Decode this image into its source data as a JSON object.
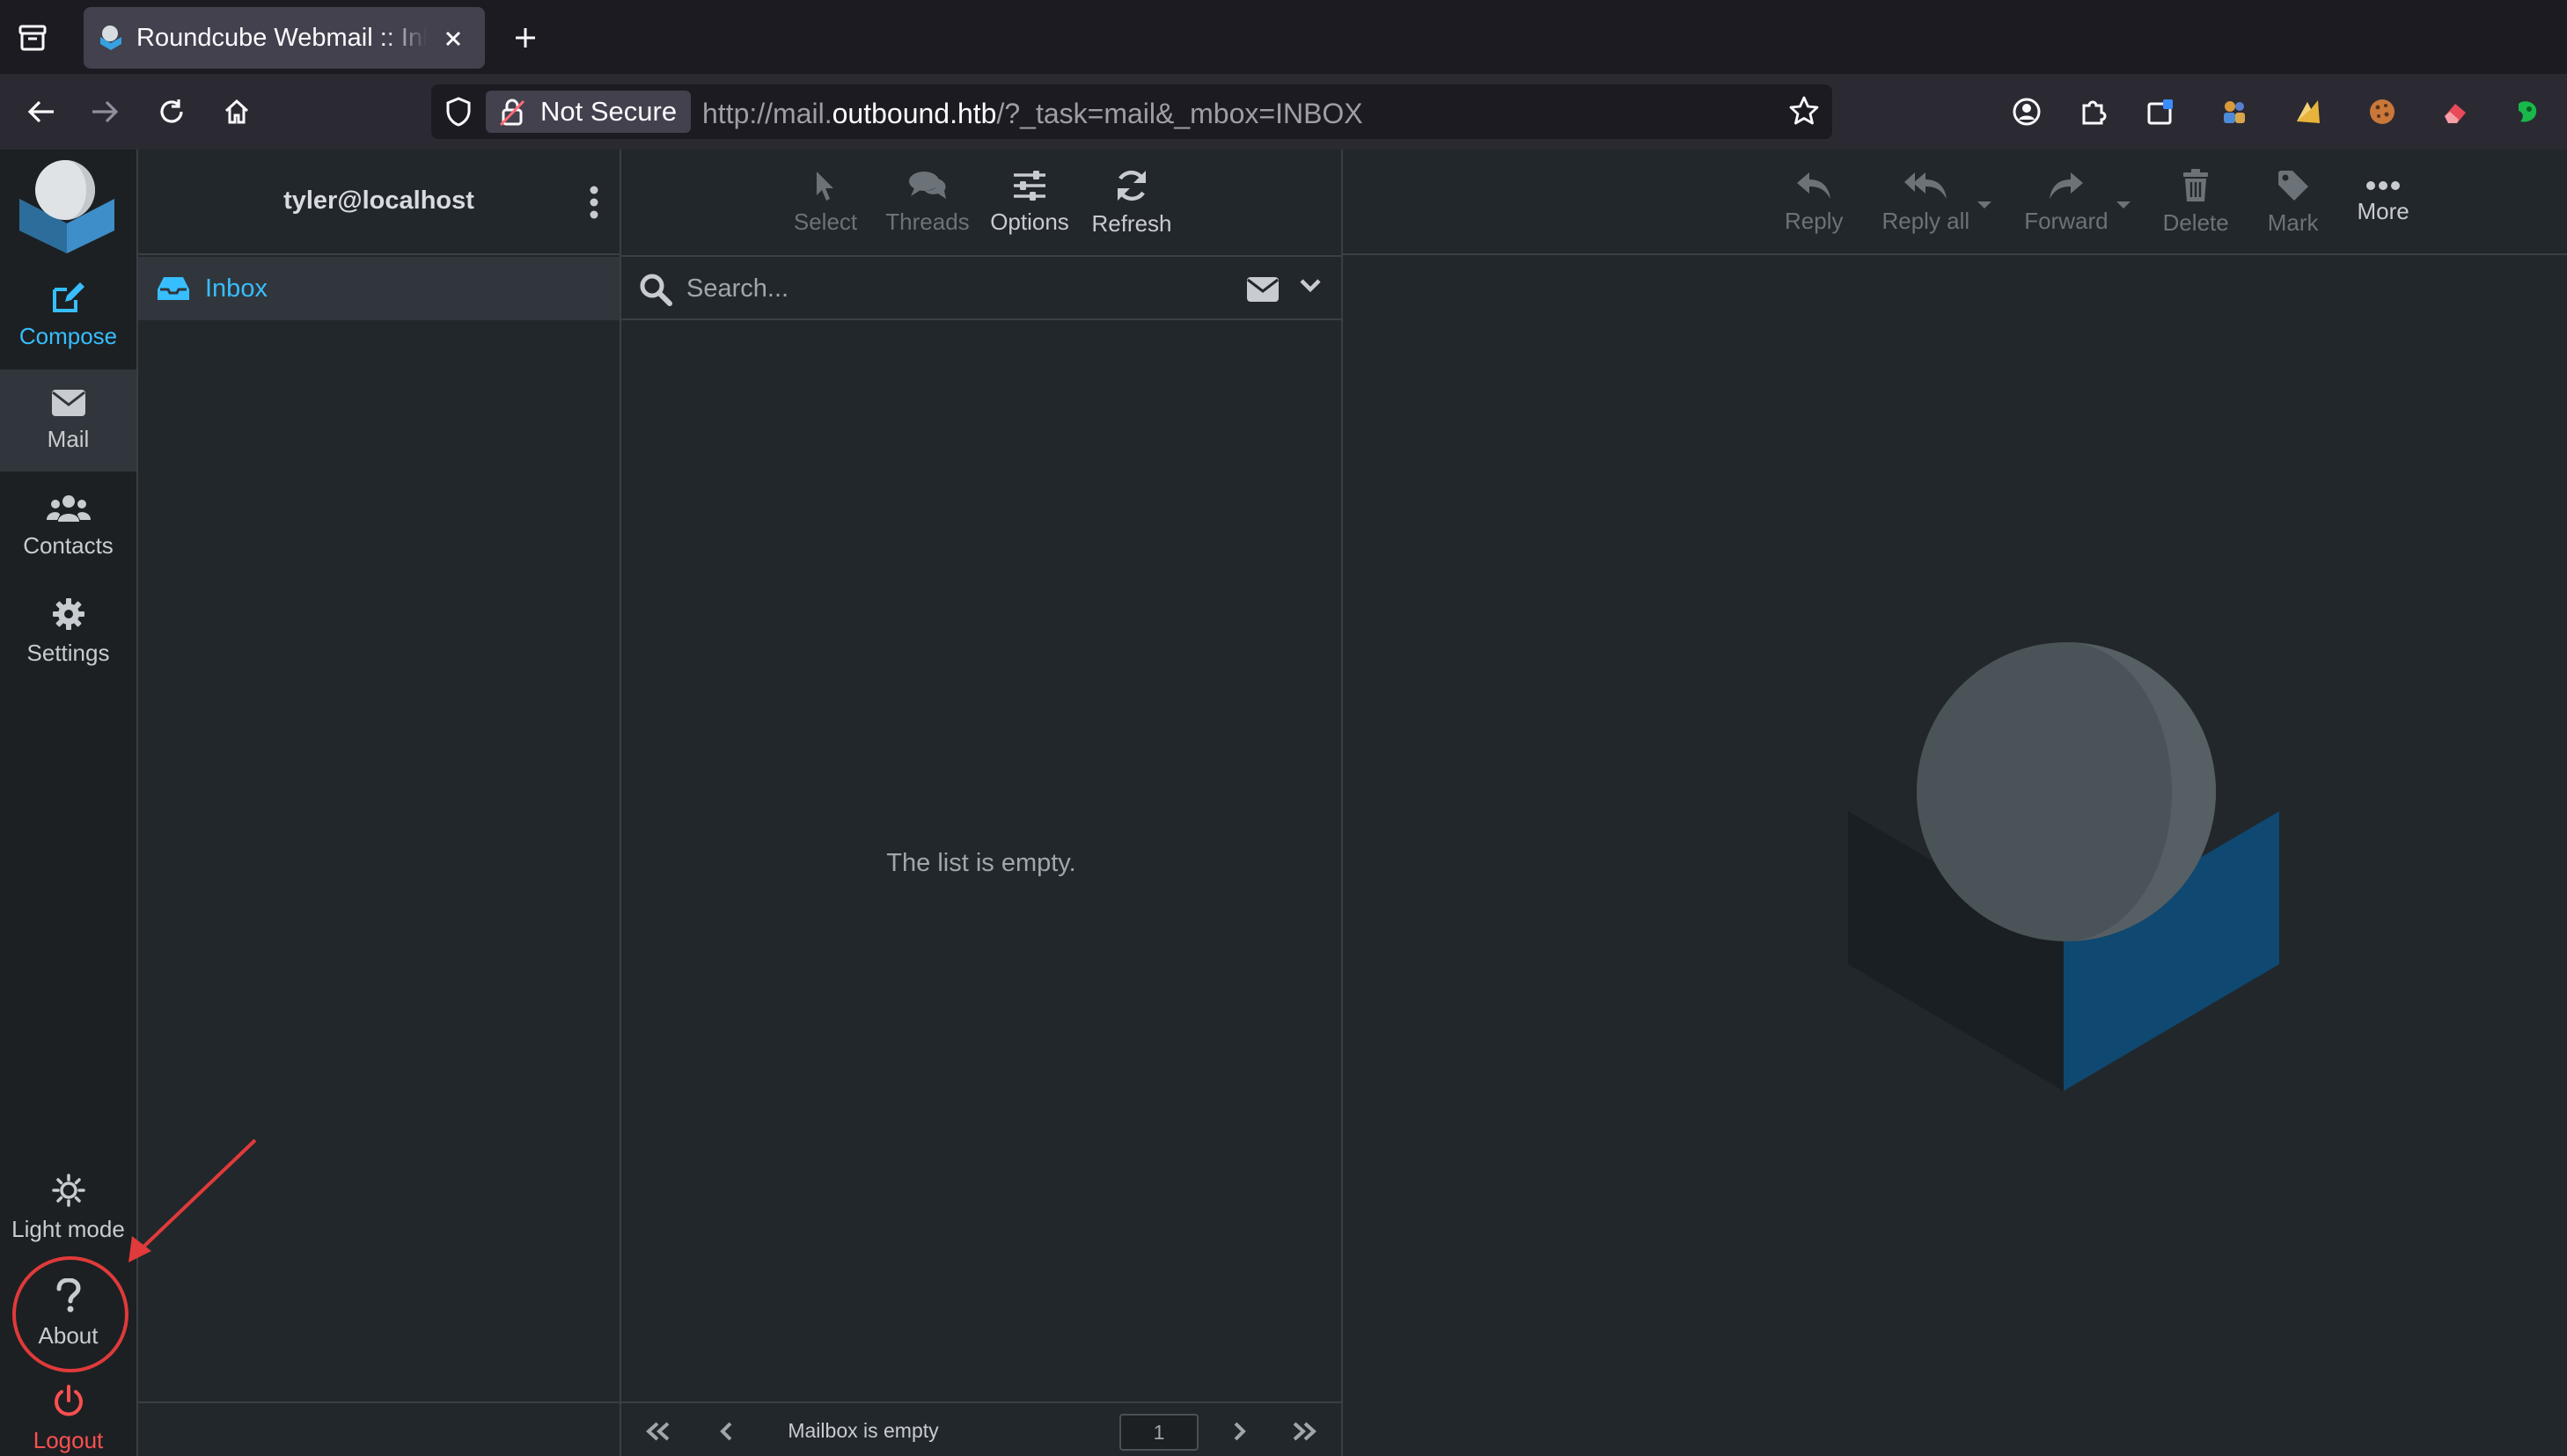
{
  "browser": {
    "tab_title": "Roundcube Webmail :: Inbox",
    "security_label": "Not Secure",
    "url_prefix": "http://mail.",
    "url_host": "outbound.htb",
    "url_path": "/?_task=mail&_mbox=INBOX"
  },
  "taskmenu": {
    "compose": "Compose",
    "mail": "Mail",
    "contacts": "Contacts",
    "settings": "Settings",
    "light_mode": "Light mode",
    "about": "About",
    "logout": "Logout"
  },
  "folders": {
    "username": "tyler@localhost",
    "items": [
      {
        "label": "Inbox"
      }
    ]
  },
  "list_toolbar": {
    "select": "Select",
    "threads": "Threads",
    "options": "Options",
    "refresh": "Refresh"
  },
  "search": {
    "placeholder": "Search..."
  },
  "message_list": {
    "empty_text": "The list is empty.",
    "count_text": "Mailbox is empty",
    "page": "1"
  },
  "message_toolbar": {
    "reply": "Reply",
    "reply_all": "Reply all",
    "forward": "Forward",
    "delete": "Delete",
    "mark": "Mark",
    "more": "More"
  },
  "colors": {
    "accent": "#37beff",
    "logout": "#ff4f4f",
    "background": "#22272b",
    "annotation": "#e03a3a"
  }
}
